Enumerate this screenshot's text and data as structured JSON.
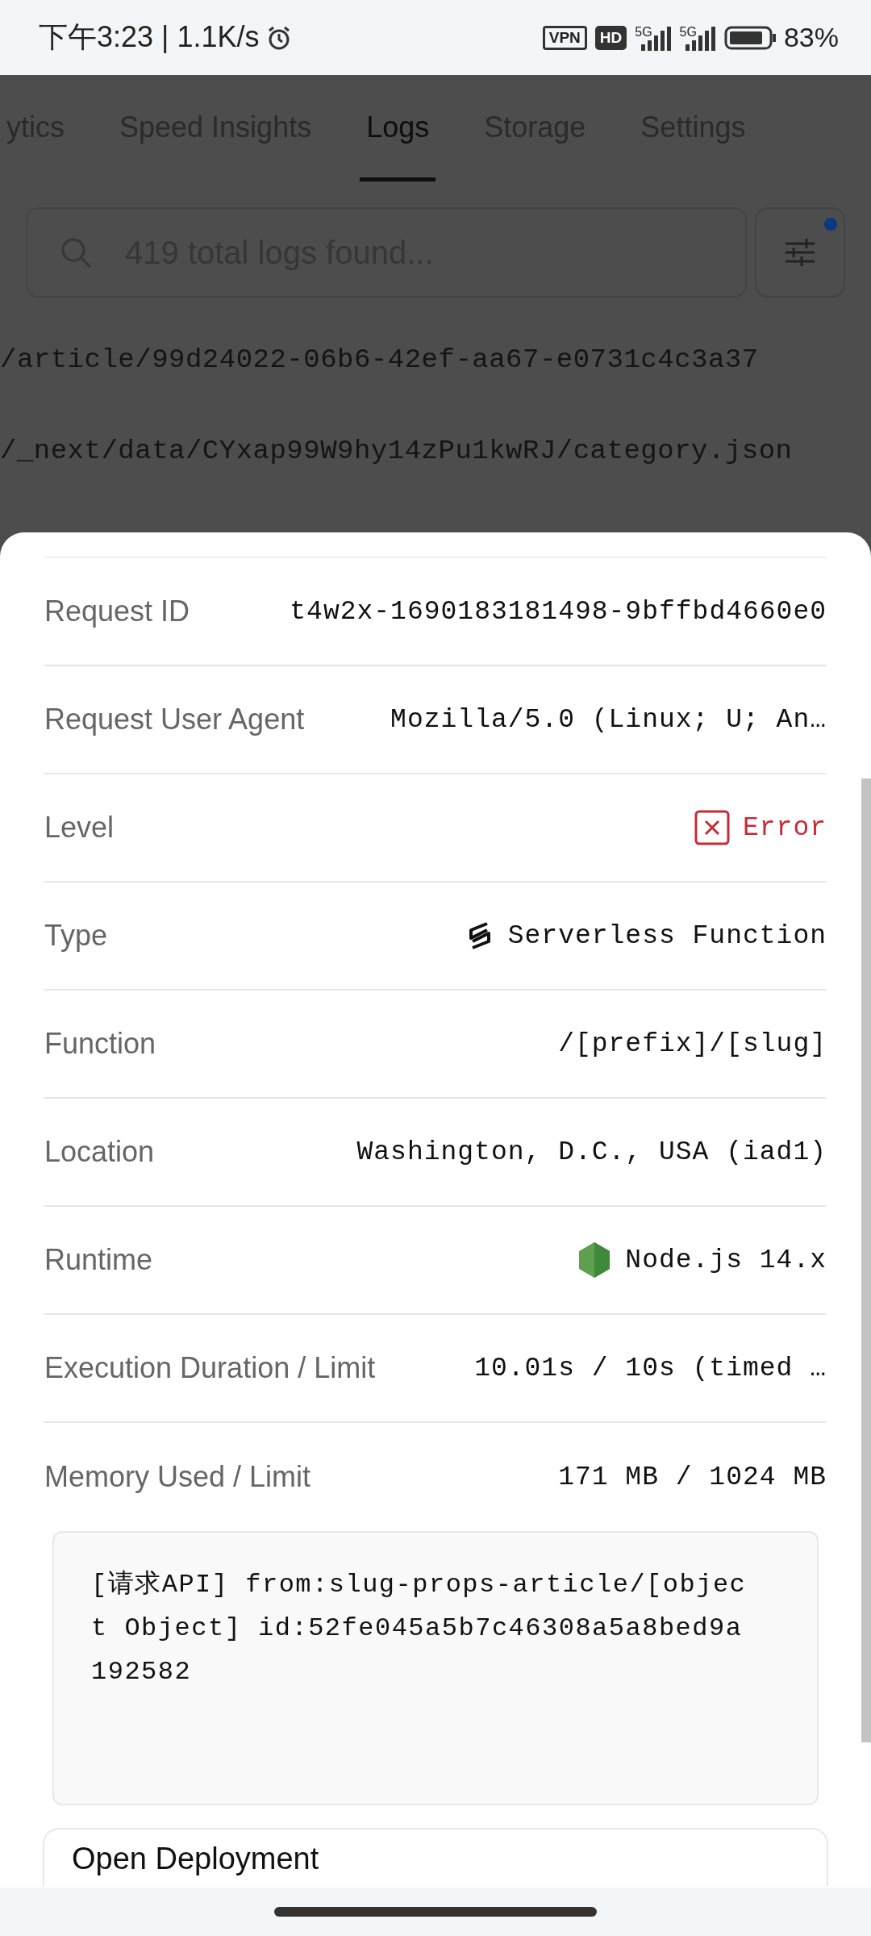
{
  "status_bar": {
    "time": "下午3:23 | 1.1K/s",
    "vpn": "VPN",
    "hd": "HD",
    "network_1": "5G",
    "network_2": "5G",
    "battery": "83%"
  },
  "tabs": [
    {
      "label": "ytics",
      "selected": false
    },
    {
      "label": "Speed Insights",
      "selected": false
    },
    {
      "label": "Logs",
      "selected": true
    },
    {
      "label": "Storage",
      "selected": false
    },
    {
      "label": "Settings",
      "selected": false
    }
  ],
  "search": {
    "placeholder": "419 total logs found...",
    "filter_active": true
  },
  "logs": [
    "/article/99d24022-06b6-42ef-aa67-e0731c4c3a37",
    "/_next/data/CYxap99W9hy14zPu1kwRJ/category.json"
  ],
  "details": {
    "rows": [
      {
        "label": "Request ID",
        "value": "t4w2x-1690183181498-9bffbd4660e0",
        "kind": "plain"
      },
      {
        "label": "Request User Agent",
        "value": "Mozilla/5.0 (Linux; U; An…",
        "kind": "plain"
      },
      {
        "label": "Level",
        "value": "Error",
        "kind": "error"
      },
      {
        "label": "Type",
        "value": "Serverless Function",
        "kind": "serverless"
      },
      {
        "label": "Function",
        "value": "/[prefix]/[slug]",
        "kind": "plain"
      },
      {
        "label": "Location",
        "value": "Washington, D.C., USA (iad1)",
        "kind": "plain"
      },
      {
        "label": "Runtime",
        "value": "Node.js 14.x",
        "kind": "node"
      },
      {
        "label": "Execution Duration / Limit",
        "value": "10.01s / 10s (timed …",
        "kind": "plain"
      },
      {
        "label": "Memory Used / Limit",
        "value": "171 MB / 1024 MB",
        "kind": "plain"
      }
    ],
    "message": "[请求API] from:slug-props-article/[object Object] id:52fe045a5b7c46308a5a8bed9a192582",
    "action": "Open Deployment"
  }
}
